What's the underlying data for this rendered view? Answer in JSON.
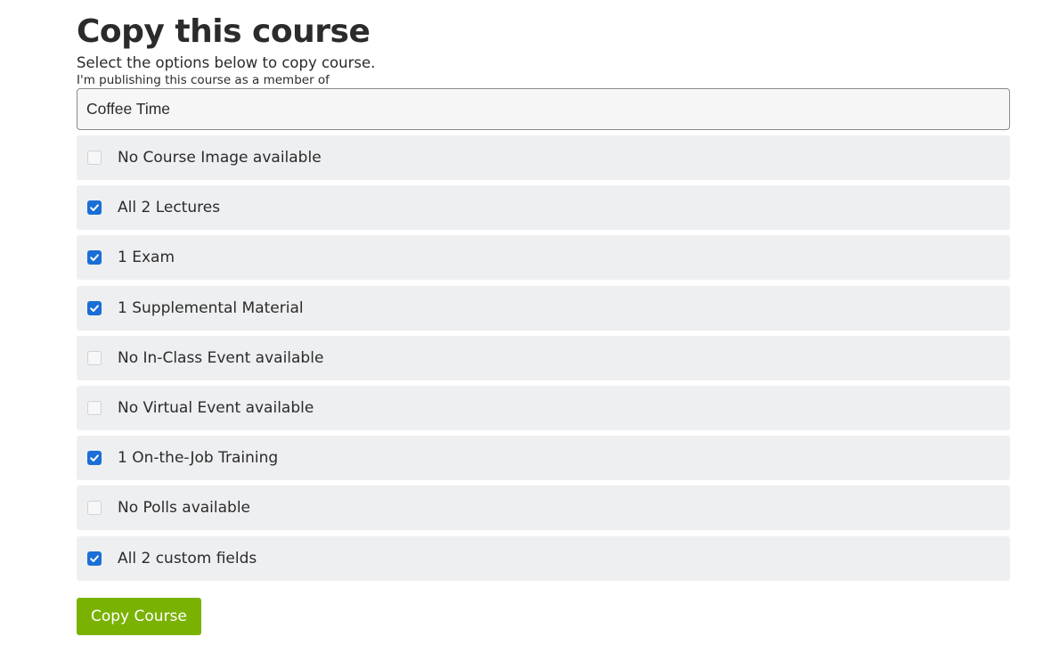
{
  "page": {
    "title": "Copy this course",
    "subtitle": "Select the options below to copy course.",
    "member_label": "I'm publishing this course as a member of",
    "organization": "Coffee Time"
  },
  "options": [
    {
      "label": "No Course Image available",
      "checked": false
    },
    {
      "label": "All 2 Lectures",
      "checked": true
    },
    {
      "label": "1 Exam",
      "checked": true
    },
    {
      "label": "1 Supplemental Material",
      "checked": true
    },
    {
      "label": "No In-Class Event available",
      "checked": false
    },
    {
      "label": "No Virtual Event available",
      "checked": false
    },
    {
      "label": "1 On-the-Job Training",
      "checked": true
    },
    {
      "label": "No Polls available",
      "checked": false
    },
    {
      "label": "All 2 custom fields",
      "checked": true
    }
  ],
  "actions": {
    "copy_label": "Copy Course"
  },
  "colors": {
    "accent_button": "#7ab202",
    "checkbox_checked": "#1a6fd6",
    "row_background": "#eeeff1"
  }
}
